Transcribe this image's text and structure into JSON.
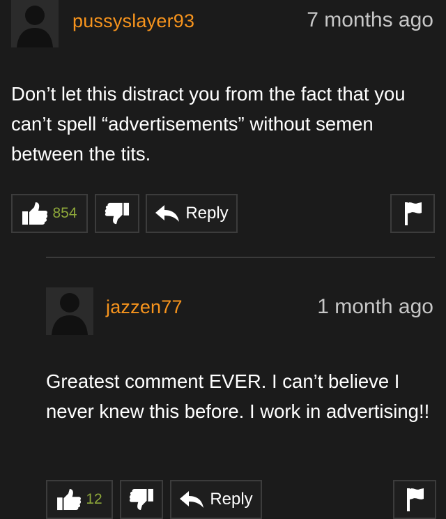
{
  "comments": [
    {
      "username": "pussyslayer93",
      "time": "7 months ago",
      "text": "Don’t let this distract you from the fact that you can’t spell “advertisements” without semen between the tits.",
      "likes": "854",
      "reply_label": "Reply"
    },
    {
      "username": "jazzen77",
      "time": "1 month ago",
      "text": "Greatest comment EVER. I can’t believe I never knew this before. I work in advertising!!",
      "likes": "12",
      "reply_label": "Reply"
    }
  ],
  "colors": {
    "background": "#1b1b1b",
    "username": "#f7941d",
    "timestamp": "#c7c7c7",
    "like_count": "#8ea83a",
    "button_border": "#3c3c3c"
  }
}
